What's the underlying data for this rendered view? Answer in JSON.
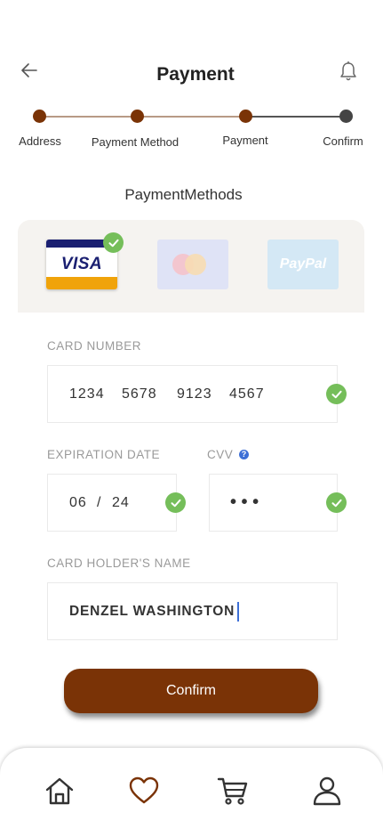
{
  "header": {
    "title": "Payment"
  },
  "stepper": {
    "steps": [
      "Address",
      "Payment Method",
      "Payment",
      "Confirm"
    ],
    "current_step": 3,
    "colors": {
      "done": "#7a3306",
      "pending": "#444444"
    }
  },
  "section_title": "PaymentMethods",
  "payment_methods": {
    "selected": "visa",
    "options": [
      {
        "icon": "visa-logo",
        "text": "VISA"
      },
      {
        "icon": "mastercard-logo",
        "text": ""
      },
      {
        "icon": "paypal-logo",
        "text": "PayPal"
      }
    ]
  },
  "form": {
    "card_number": {
      "label": "CARD NUMBER",
      "groups": [
        "1234",
        "5678",
        "9123",
        "4567"
      ]
    },
    "expiration": {
      "label": "EXPIRATION DATE",
      "month": "06",
      "separator": "/",
      "year": "24"
    },
    "cvv": {
      "label": "CVV",
      "value": "• • •",
      "help": "?"
    },
    "holder": {
      "label": "CARD HOLDER'S NAME",
      "value": "DENZEL WASHINGTON"
    }
  },
  "confirm_label": "Confirm",
  "bottom_nav": {
    "items": [
      "home-icon",
      "heart-icon",
      "cart-icon",
      "user-icon"
    ],
    "active": "heart-icon"
  },
  "colors": {
    "accent": "#7a3306",
    "success": "#75be5a",
    "info": "#3d6fd6"
  }
}
